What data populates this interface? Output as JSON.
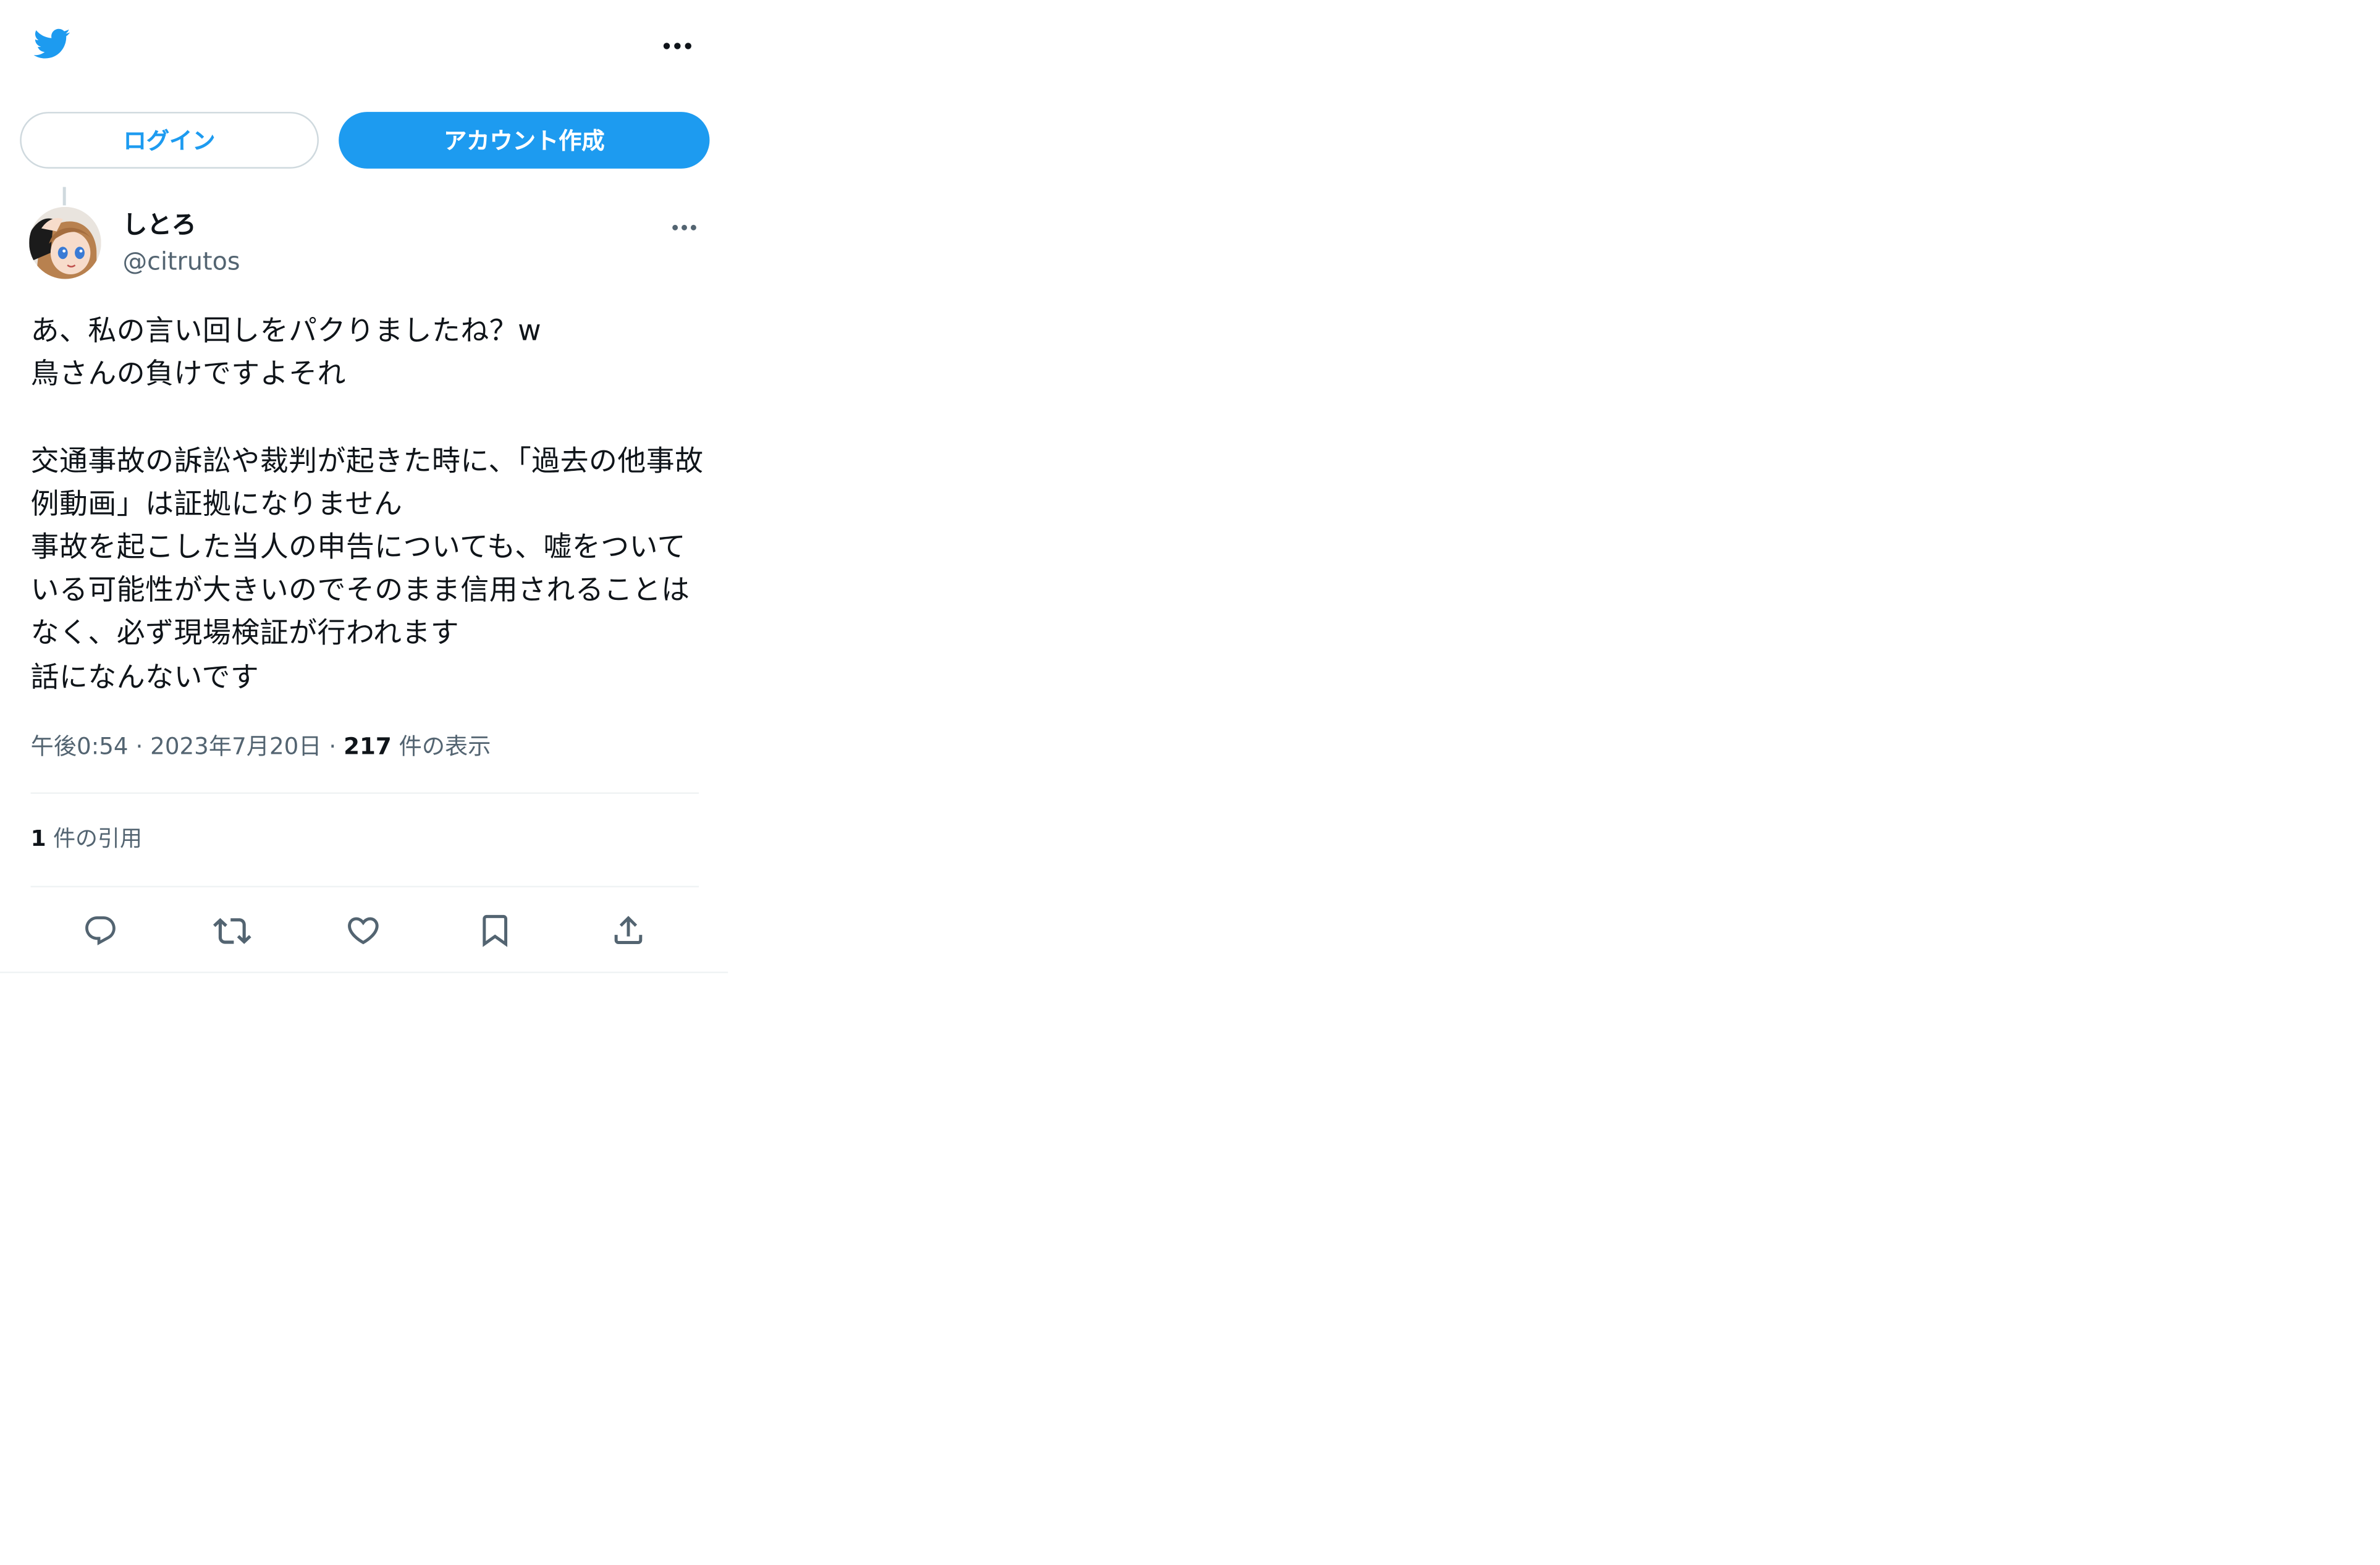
{
  "brand": {
    "logo_icon": "twitter-bird-icon",
    "color": "#1d9bf0"
  },
  "header": {
    "more_icon": "more-horizontal-icon"
  },
  "auth": {
    "login_label": "ログイン",
    "signup_label": "アカウント作成"
  },
  "tweet": {
    "author": {
      "display_name": "しとろ",
      "handle": "@citrutos",
      "avatar_icon": "avatar"
    },
    "more_icon": "more-horizontal-icon",
    "text": "あ、私の言い回しをパクりましたね？w\n鳥さんの負けですよそれ\n\n交通事故の訴訟や裁判が起きた時に、「過去の他事故例動画」は証拠になりません\n事故を起こした当人の申告についても、嘘をついている可能性が大きいのでそのまま信用されることはなく、必ず現場検証が行われます\n話になんないです",
    "time": "午後0:54",
    "date": "2023年7月20日",
    "separator": "·",
    "views_count": "217",
    "views_label": "件の表示",
    "quotes_count": "1",
    "quotes_label": "件の引用"
  },
  "actions": [
    {
      "name": "reply",
      "icon": "reply-icon"
    },
    {
      "name": "retweet",
      "icon": "retweet-icon"
    },
    {
      "name": "like",
      "icon": "heart-icon"
    },
    {
      "name": "bookmark",
      "icon": "bookmark-icon"
    },
    {
      "name": "share",
      "icon": "share-icon"
    }
  ],
  "colors": {
    "accent": "#1d9bf0",
    "text_primary": "#0f1419",
    "text_secondary": "#536471",
    "border": "#cfd9de",
    "divider": "#eff3f4"
  }
}
